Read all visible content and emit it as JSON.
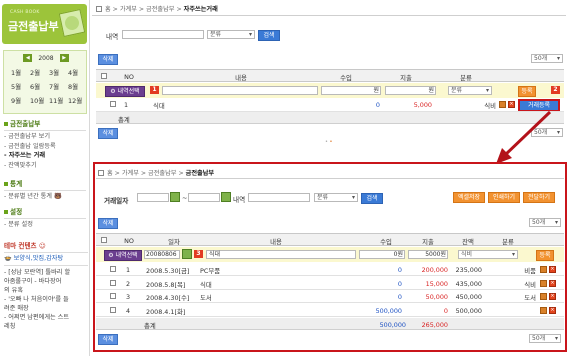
{
  "sidebar": {
    "logo_small": "CASH BOOK",
    "logo_big": "금전출납부",
    "calendar_year": "2008",
    "months": [
      "1월",
      "2월",
      "3월",
      "4월",
      "5월",
      "6월",
      "7월",
      "8월",
      "9월",
      "10월",
      "11월",
      "12월"
    ],
    "section1_title": "금전출납부",
    "section1_items": [
      "금전출납부 보기",
      "금전출납 일람등록",
      "자주쓰는 거래",
      "잔액맞추기"
    ],
    "section2_title": "통계",
    "section2_items": [
      "분류별 년간 통계 🐻"
    ],
    "section3_title": "설정",
    "section3_items": [
      "분류 설정"
    ],
    "theme_title": "테마 컨텐츠 ☺",
    "theme_tag": "보양식,맛집,감자탕",
    "theme_rows": [
      "[성남 모란역] 톨바리 할",
      "아줌롤구이 - 바다장어",
      "의 유혹",
      "'오빠 나 처음이야'를 들",
      "려준 매장",
      "- 어쩌면 남편에게는 스트",
      "레칭"
    ]
  },
  "top": {
    "breadcrumb_home": "홈",
    "breadcrumb_1": "가계부",
    "breadcrumb_2": "금전출납부",
    "breadcrumb_current": "자주쓰는거래",
    "content_label": "내역",
    "category_select": "분류",
    "search_button": "검색",
    "page_size": "50개",
    "delete_button": "삭제",
    "headers": [
      "NO",
      "내용",
      "수입",
      "지출",
      "분류"
    ],
    "new_row": {
      "item_select": "내역선택",
      "badge": "1",
      "income_unit": "원",
      "expense_unit": "원",
      "category_select": "분류",
      "register": "등록",
      "badge2": "2"
    },
    "rows": [
      {
        "no": "1",
        "content": "식대",
        "income": "0",
        "expense": "5,000",
        "category": "식비",
        "action": "거래등록"
      }
    ],
    "total_label": "총계"
  },
  "bottom": {
    "breadcrumb_home": "홈",
    "breadcrumb_1": "가계부",
    "breadcrumb_2": "금전출납부",
    "breadcrumb_current": "금전출납부",
    "date_label": "거래일자",
    "date_sep": "~",
    "content_label": "내역",
    "category_select": "분류",
    "search_button": "검색",
    "excel_button": "엑셀저장",
    "print_button": "인쇄하기",
    "print2_button": "전달하기",
    "page_size": "50개",
    "delete_button": "삭제",
    "headers": [
      "NO",
      "일자",
      "내용",
      "수입",
      "지출",
      "잔액",
      "분류"
    ],
    "new_row": {
      "item_select": "내역선택",
      "date": "20080806",
      "badge": "3",
      "content": "식대",
      "income_unit": "0원",
      "expense_unit": "5000원",
      "category_select": "식비",
      "register": "등록"
    },
    "rows": [
      {
        "no": "1",
        "date": "2008.5.30[금]",
        "content": "PC부품",
        "income": "0",
        "expense": "200,000",
        "balance": "235,000",
        "category": "비품"
      },
      {
        "no": "2",
        "date": "2008.5.8[목]",
        "content": "식대",
        "income": "0",
        "expense": "15,000",
        "balance": "435,000",
        "category": "식비"
      },
      {
        "no": "3",
        "date": "2008.4.30[수]",
        "content": "도서",
        "income": "0",
        "expense": "50,000",
        "balance": "450,000",
        "category": "도서"
      },
      {
        "no": "4",
        "date": "2008.4.1[화]",
        "content": "",
        "income": "500,000",
        "expense": "0",
        "balance": "500,000",
        "category": ""
      }
    ],
    "total_label": "총계",
    "total_income": "500,000",
    "total_expense": "265,000"
  }
}
